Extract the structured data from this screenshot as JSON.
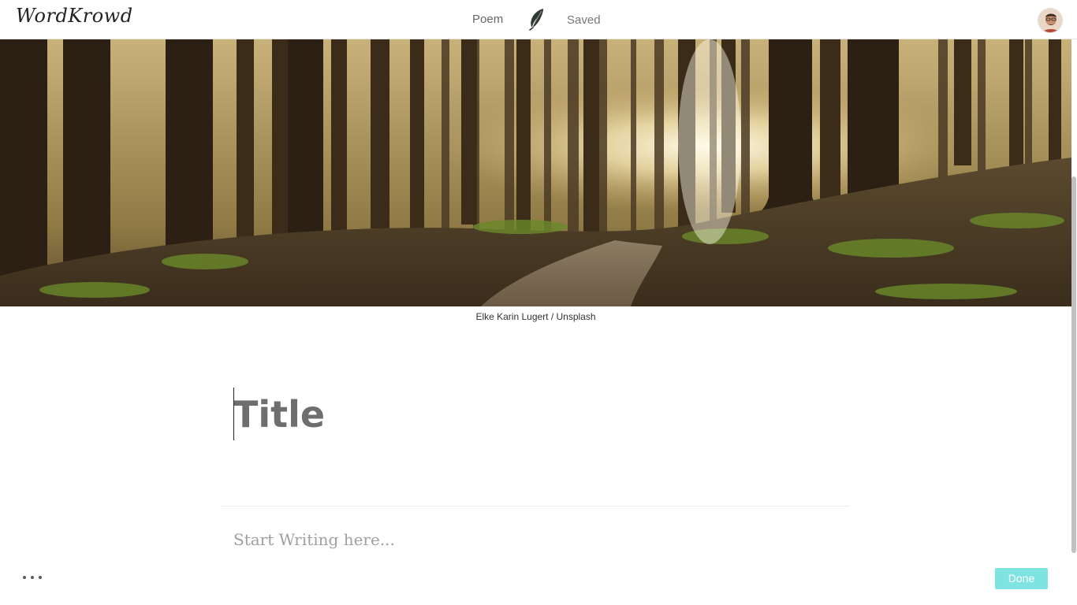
{
  "header": {
    "logo": "WordKrowd",
    "nav": {
      "poem_label": "Poem",
      "saved_label": "Saved"
    },
    "icons": {
      "quill": "quill-icon",
      "avatar": "user-avatar"
    }
  },
  "cover": {
    "caption": "Elke Karin Lugert / Unsplash"
  },
  "editor": {
    "title_placeholder": "Title",
    "body_placeholder": "Start Writing here..."
  },
  "footer": {
    "more_icon": "more-horizontal-icon",
    "done_label": "Done"
  },
  "colors": {
    "accent": "#7fe3e1",
    "text_muted": "#a0a0a0"
  }
}
